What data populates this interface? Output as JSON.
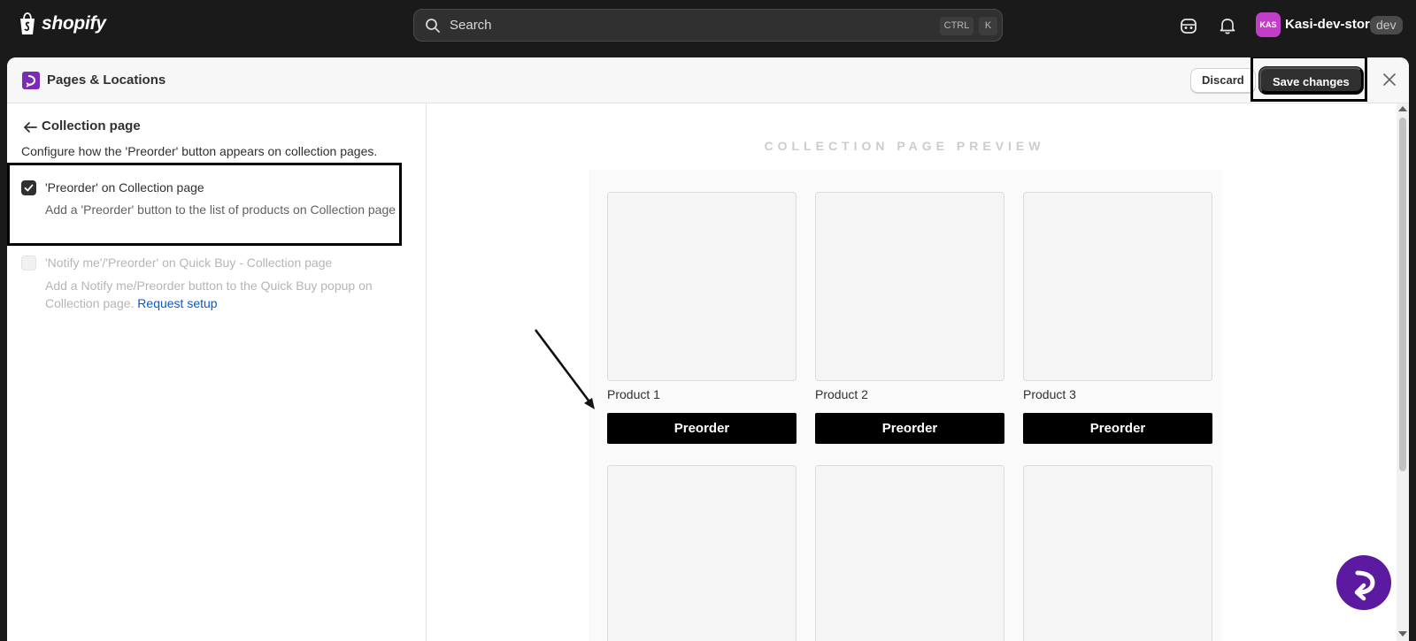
{
  "topbar": {
    "logo_text": "shopify",
    "search_placeholder": "Search",
    "shortcut_ctrl": "CTRL",
    "shortcut_k": "K",
    "avatar_initials": "KAS",
    "store_name": "Kasi-dev-store",
    "store_badge": "dev",
    "icons": [
      "shopify-bag-icon",
      "search-icon",
      "sidekick-icon",
      "bell-icon"
    ]
  },
  "modal": {
    "title": "Pages & Locations",
    "discard_label": "Discard",
    "save_label": "Save changes",
    "icons": [
      "app-icon",
      "close-icon"
    ]
  },
  "settings": {
    "section_title": "Collection page",
    "description": "Configure how the 'Preorder' button appears on collection pages.",
    "options": [
      {
        "label": "'Preorder' on Collection page",
        "help": "Add a 'Preorder' button to the list of products on Collection page",
        "checked": true,
        "disabled": false
      },
      {
        "label": "'Notify me'/'Preorder' on Quick Buy - Collection page",
        "help": "Add a Notify me/Preorder button to the Quick Buy popup on Collection page.",
        "link_text": "Request setup",
        "checked": false,
        "disabled": true
      }
    ]
  },
  "preview": {
    "title": "COLLECTION PAGE PREVIEW",
    "products": [
      {
        "name": "Product 1",
        "button": "Preorder"
      },
      {
        "name": "Product 2",
        "button": "Preorder"
      },
      {
        "name": "Product 3",
        "button": "Preorder"
      }
    ]
  },
  "colors": {
    "topbar_bg": "#1a1a1a",
    "accent_purple": "#5c1aa0",
    "link_blue": "#005bd3",
    "avatar_bg": "#c33ec8"
  }
}
